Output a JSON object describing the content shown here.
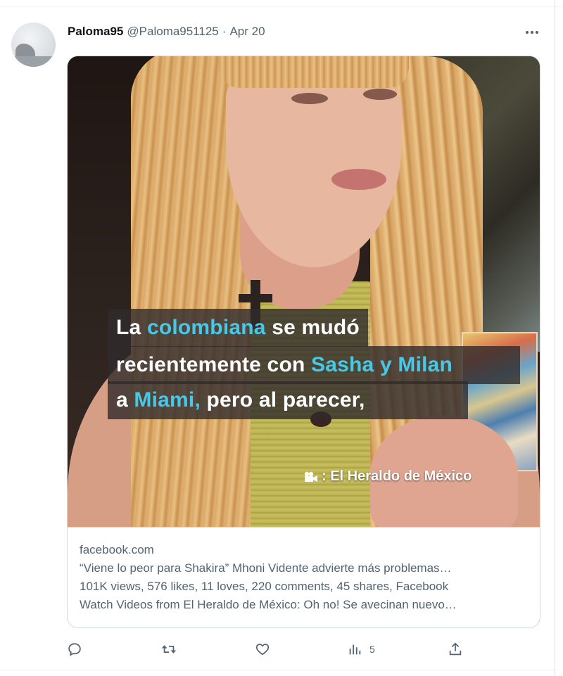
{
  "tweet": {
    "display_name": "Paloma95",
    "handle": "@Paloma951125",
    "separator": "·",
    "date": "Apr 20"
  },
  "video_caption": {
    "line1_a": "La ",
    "line1_hl": "colombiana",
    "line1_b": " se mudó",
    "line2_a": "recientemente con ",
    "line2_hl": "Sasha y Milan",
    "line3_a": "a ",
    "line3_hl": "Miami,",
    "line3_b": " pero al parecer,",
    "highlight_color": "#48c8e9"
  },
  "video_credit": {
    "icon": "video-camera-icon",
    "text": ": El Heraldo de México"
  },
  "link_card": {
    "domain": "facebook.com",
    "title": "“Viene lo peor para Shakira” Mhoni Vidente advierte más problemas…",
    "desc_line1": "101K views, 576 likes, 11 loves, 220 comments, 45 shares, Facebook",
    "desc_line2": "Watch Videos from El Heraldo de México: Oh no! Se avecinan nuevo…"
  },
  "actions": {
    "views_count": "5"
  },
  "colors": {
    "text_primary": "#0f1419",
    "text_secondary": "#536471",
    "border": "#cfd9de"
  }
}
